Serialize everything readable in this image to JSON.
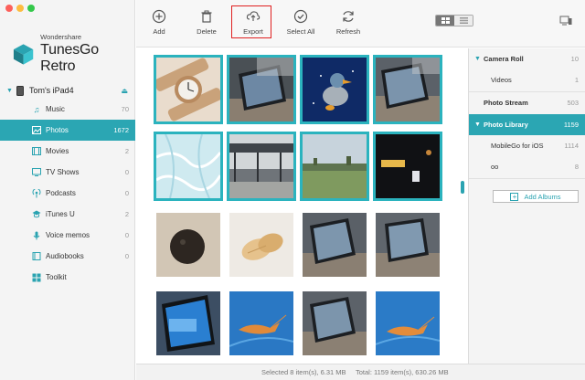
{
  "app": {
    "brand_small": "Wondershare",
    "brand_name": "TunesGo Retro"
  },
  "device": {
    "name": "Tom's iPad4"
  },
  "sidebar": {
    "items": [
      {
        "label": "Music",
        "count": "70",
        "icon": "music-icon"
      },
      {
        "label": "Photos",
        "count": "1672",
        "icon": "photos-icon",
        "active": true
      },
      {
        "label": "Movies",
        "count": "2",
        "icon": "movies-icon"
      },
      {
        "label": "TV Shows",
        "count": "0",
        "icon": "tv-icon"
      },
      {
        "label": "Podcasts",
        "count": "0",
        "icon": "podcast-icon"
      },
      {
        "label": "iTunes U",
        "count": "2",
        "icon": "itunes-u-icon"
      },
      {
        "label": "Voice memos",
        "count": "0",
        "icon": "voice-memo-icon"
      },
      {
        "label": "Audiobooks",
        "count": "0",
        "icon": "audiobook-icon"
      },
      {
        "label": "Toolkit",
        "count": "",
        "icon": "toolkit-icon"
      }
    ]
  },
  "toolbar": {
    "add": "Add",
    "delete": "Delete",
    "export": "Export",
    "select_all": "Select All",
    "refresh": "Refresh"
  },
  "albums": {
    "camera_roll": {
      "label": "Camera Roll",
      "count": "10"
    },
    "videos": {
      "label": "Videos",
      "count": "1"
    },
    "photo_stream": {
      "label": "Photo Stream",
      "count": "503"
    },
    "photo_library": {
      "label": "Photo Library",
      "count": "1159"
    },
    "mobilego": {
      "label": "MobileGo for iOS",
      "count": "1114"
    },
    "oo": {
      "label": "oo",
      "count": "8"
    },
    "add_albums": "Add Albums"
  },
  "status": {
    "selected": "Selected 8 item(s), 6.31 MB",
    "total": "Total: 1159 item(s), 630.26 MB"
  },
  "colors": {
    "accent": "#2ba6b3",
    "selection": "#2bb3be",
    "export_highlight": "#e02020"
  },
  "photos": [
    {
      "subject": "wristwatch",
      "selected": true
    },
    {
      "subject": "ipad-on-table",
      "selected": true
    },
    {
      "subject": "bird-cartoon",
      "selected": true
    },
    {
      "subject": "ipad-on-table",
      "selected": true
    },
    {
      "subject": "ice-texture",
      "selected": true
    },
    {
      "subject": "train-station",
      "selected": true
    },
    {
      "subject": "field-landscape",
      "selected": true
    },
    {
      "subject": "night-sign",
      "selected": true
    },
    {
      "subject": "round-speaker",
      "selected": false
    },
    {
      "subject": "bread-rolls",
      "selected": false
    },
    {
      "subject": "ipad-on-table",
      "selected": false
    },
    {
      "subject": "ipad-on-table",
      "selected": false
    },
    {
      "subject": "ipad-screen",
      "selected": false
    },
    {
      "subject": "shrimp-on-blue",
      "selected": false
    },
    {
      "subject": "ipad-on-table",
      "selected": false
    },
    {
      "subject": "shrimp-on-blue",
      "selected": false
    }
  ]
}
